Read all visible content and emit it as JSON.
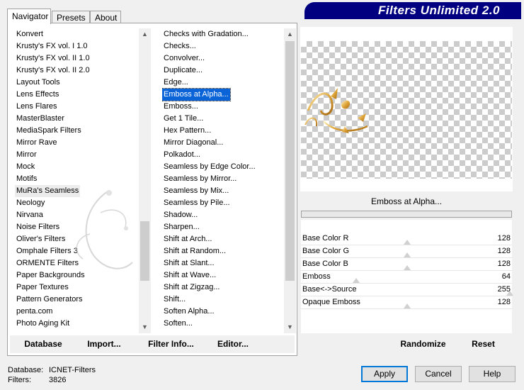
{
  "banner": {
    "title": "Filters Unlimited 2.0"
  },
  "tabs": [
    {
      "label": "Navigator",
      "active": true
    },
    {
      "label": "Presets",
      "active": false
    },
    {
      "label": "About",
      "active": false
    }
  ],
  "categories": [
    "Konvert",
    "Krusty's FX vol. I 1.0",
    "Krusty's FX vol. II 1.0",
    "Krusty's FX vol. II 2.0",
    "Layout Tools",
    "Lens Effects",
    "Lens Flares",
    "MasterBlaster",
    "MediaSpark Filters",
    "Mirror Rave",
    "Mirror",
    "Mock",
    "Motifs",
    "MuRa's Seamless",
    "Neology",
    "Nirvana",
    "Noise Filters",
    "Oliver's Filters",
    "Omphale Filters 3",
    "ORMENTE Filters",
    "Paper Backgrounds",
    "Paper Textures",
    "Pattern Generators",
    "penta.com",
    "Photo Aging Kit"
  ],
  "categories_selected": "MuRa's Seamless",
  "filters": [
    "Checks with Gradation...",
    "Checks...",
    "Convolver...",
    "Duplicate...",
    "Edge...",
    "Emboss at Alpha...",
    "Emboss...",
    "Get 1 Tile...",
    "Hex Pattern...",
    "Mirror Diagonal...",
    "Polkadot...",
    "Seamless by Edge Color...",
    "Seamless by Mirror...",
    "Seamless by Mix...",
    "Seamless by Pile...",
    "Shadow...",
    "Sharpen...",
    "Shift at Arch...",
    "Shift at Random...",
    "Shift at Slant...",
    "Shift at Wave...",
    "Shift at Zigzag...",
    "Shift...",
    "Soften Alpha...",
    "Soften..."
  ],
  "filters_selected": "Emboss at Alpha...",
  "panel_buttons": {
    "database": "Database",
    "import": "Import...",
    "filter_info": "Filter Info...",
    "editor": "Editor..."
  },
  "preview": {
    "filter_name": "Emboss at Alpha..."
  },
  "params": [
    {
      "name": "Base Color R",
      "value": "128",
      "level": 0.5
    },
    {
      "name": "Base Color G",
      "value": "128",
      "level": 0.5
    },
    {
      "name": "Base Color B",
      "value": "128",
      "level": 0.5
    },
    {
      "name": "Emboss",
      "value": "64",
      "level": 0.25
    },
    {
      "name": "Base<->Source",
      "value": "255",
      "level": 1.0
    },
    {
      "name": "Opaque Emboss",
      "value": "128",
      "level": 0.5
    }
  ],
  "right_buttons": {
    "randomize": "Randomize",
    "reset": "Reset"
  },
  "footer": {
    "database_label": "Database:",
    "database_value": "ICNET-Filters",
    "filters_label": "Filters:",
    "filters_value": "3826",
    "apply": "Apply",
    "cancel": "Cancel",
    "help": "Help"
  },
  "colors": {
    "banner": "#000080",
    "selection": "#0a64d8"
  }
}
